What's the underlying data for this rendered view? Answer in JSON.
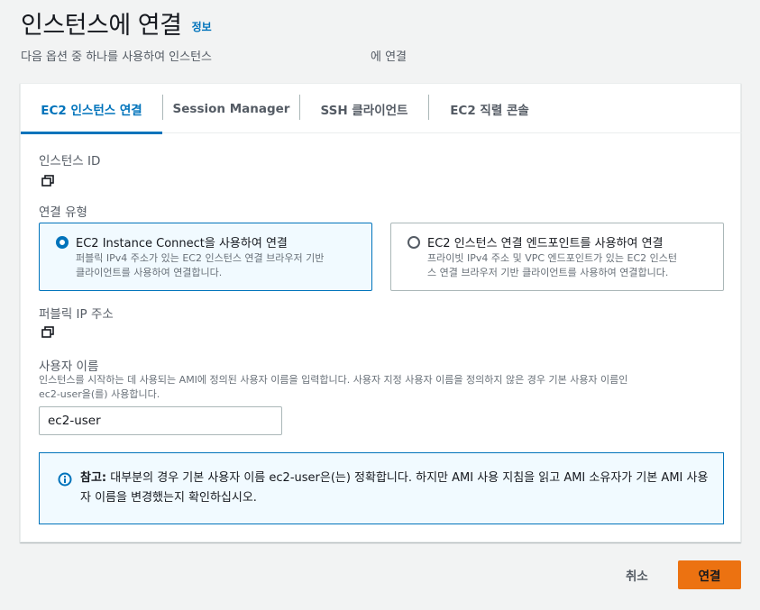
{
  "header": {
    "title": "인스턴스에 연결",
    "info_link": "정보",
    "subtitle": "다음 옵션 중 하나를 사용하여 인스턴스",
    "subtitle_suffix": "에 연결"
  },
  "tabs": [
    {
      "label": "EC2 인스턴스 연결",
      "active": true
    },
    {
      "label": "Session Manager",
      "active": false
    },
    {
      "label": "SSH 클라이언트",
      "active": false
    },
    {
      "label": "EC2 직렬 콘솔",
      "active": false
    }
  ],
  "instance_id": {
    "label": "인스턴스 ID",
    "copy_icon": "copy-icon"
  },
  "connection_type": {
    "label": "연결 유형",
    "options": [
      {
        "title": "EC2 Instance Connect을 사용하여 연결",
        "description_line1": "퍼블릭 IPv4 주소가 있는 EC2 인스턴스 연결 브라우저 기반",
        "description_line2": "클라이언트를 사용하여 연결합니다.",
        "selected": true
      },
      {
        "title": "EC2 인스턴스 연결 엔드포인트를 사용하여 연결",
        "description_line1": "프라이빗 IPv4 주소 및 VPC 엔드포인트가 있는 EC2 인스턴",
        "description_line2": "스 연결 브라우저 기반 클라이언트를 사용하여 연결합니다.",
        "selected": false
      }
    ]
  },
  "public_ip": {
    "label": "퍼블릭 IP 주소",
    "copy_icon": "copy-icon"
  },
  "username": {
    "label": "사용자 이름",
    "description_line1": "인스턴스를 시작하는 데 사용되는 AMI에 정의된 사용자 이름을 입력합니다. 사용자 지정 사용자 이름을 정의하지 않은 경우 기본 사용자 이름인",
    "description_line2": "ec2-user을(를) 사용합니다.",
    "value": "ec2-user"
  },
  "alert": {
    "icon": "info-icon",
    "bold": "참고:",
    "text": " 대부분의 경우 기본 사용자 이름 ec2-user은(는) 정확합니다. 하지만 AMI 사용 지침을 읽고 AMI 소유자가 기본 AMI 사용자 이름을 변경했는지 확인하십시오."
  },
  "footer": {
    "cancel": "취소",
    "connect": "연결"
  },
  "colors": {
    "accent": "#0073bb",
    "primary_button": "#ec7211"
  }
}
